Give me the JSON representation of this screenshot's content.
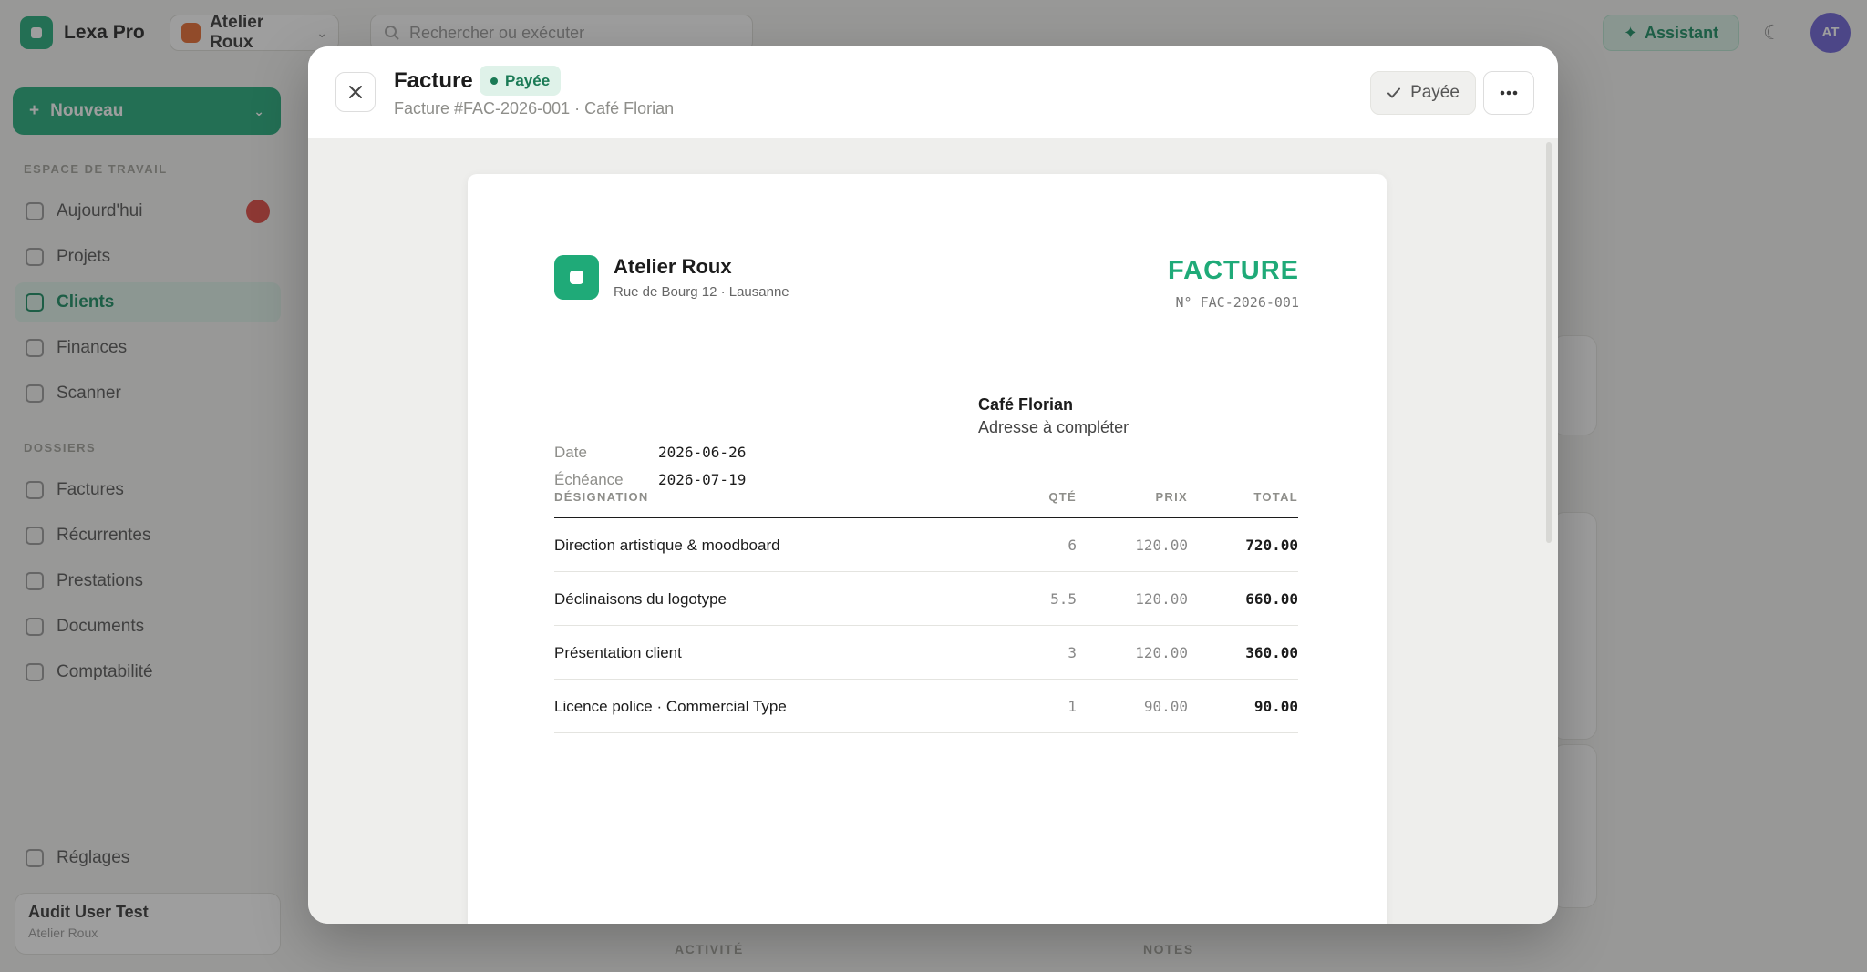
{
  "app": {
    "name": "Lexa Pro",
    "workspace": "Atelier Roux",
    "search_placeholder": "Rechercher ou exécuter",
    "assistant_label": "Assistant",
    "avatar_initials": "AT"
  },
  "sidebar": {
    "new_label": "Nouveau",
    "section_work": "ESPACE DE TRAVAIL",
    "section_docs": "DOSSIERS",
    "items": [
      {
        "label": "Aujourd'hui",
        "active": false,
        "badge": true
      },
      {
        "label": "Projets",
        "active": false
      },
      {
        "label": "Clients",
        "active": true
      },
      {
        "label": "Finances",
        "active": false
      },
      {
        "label": "Scanner",
        "active": false
      }
    ],
    "doc_items": [
      {
        "label": "Factures"
      },
      {
        "label": "Récurrentes"
      },
      {
        "label": "Prestations"
      },
      {
        "label": "Documents"
      },
      {
        "label": "Comptabilité"
      }
    ],
    "settings_label": "Réglages",
    "user_name": "Audit User Test",
    "user_role": "Atelier Roux"
  },
  "background": {
    "label_activity": "ACTIVITÉ",
    "label_notes": "NOTES"
  },
  "modal": {
    "title": "Facture",
    "status": "Payée",
    "subtitle": "Facture #FAC-2026-001 · Café Florian",
    "paid_button": "Payée",
    "status_color": "#1a7a55"
  },
  "invoice": {
    "company_name": "Atelier Roux",
    "company_address": "Rue de Bourg 12 · Lausanne",
    "doc_title": "FACTURE",
    "doc_number": "N° FAC-2026-001",
    "client_name": "Café Florian",
    "client_address": "Adresse à compléter",
    "date_label": "Date",
    "date_value": "2026-06-26",
    "due_label": "Échéance",
    "due_value": "2026-07-19",
    "accent_color": "#1faa78",
    "columns": {
      "designation": "DÉSIGNATION",
      "qty": "QTÉ",
      "price": "PRIX",
      "total": "TOTAL"
    },
    "lines": [
      {
        "designation": "Direction artistique & moodboard",
        "qty": "6",
        "price": "120.00",
        "total": "720.00"
      },
      {
        "designation": "Déclinaisons du logotype",
        "qty": "5.5",
        "price": "120.00",
        "total": "660.00"
      },
      {
        "designation": "Présentation client",
        "qty": "3",
        "price": "120.00",
        "total": "360.00"
      },
      {
        "designation": "Licence police · Commercial Type",
        "qty": "1",
        "price": "90.00",
        "total": "90.00"
      }
    ]
  }
}
